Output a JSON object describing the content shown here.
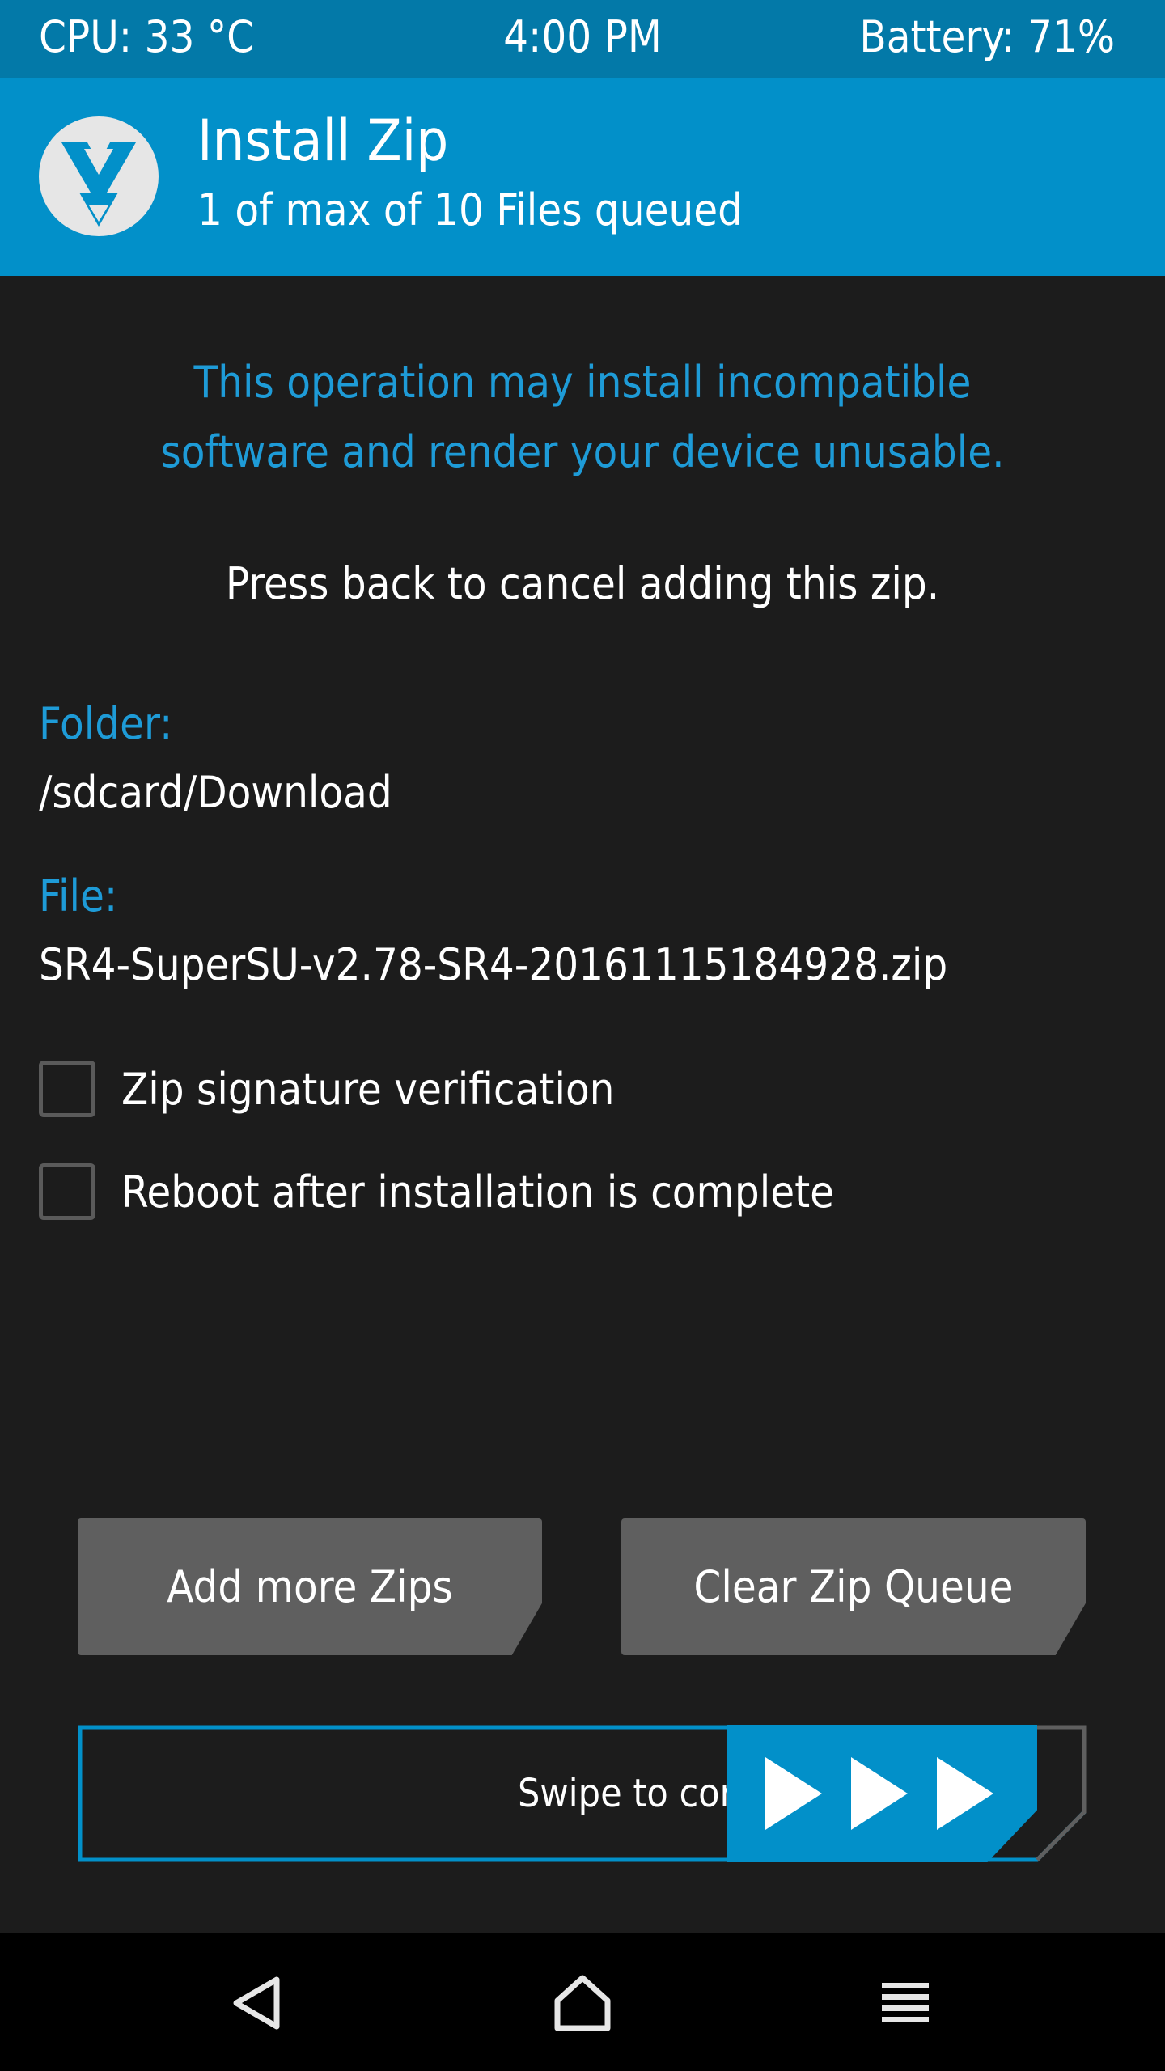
{
  "status_bar": {
    "cpu": "CPU: 33 °C",
    "time": "4:00 PM",
    "battery": "Battery: 71%"
  },
  "header": {
    "title": "Install Zip",
    "subtitle": "1 of max of 10 Files queued"
  },
  "warning": {
    "line1": "This operation may install incompatible",
    "line2": "software and render your device unusable."
  },
  "instruction": "Press back to cancel adding this zip.",
  "folder": {
    "label": "Folder:",
    "value": "/sdcard/Download"
  },
  "file": {
    "label": "File:",
    "value": "SR4-SuperSU-v2.78-SR4-20161115184928.zip"
  },
  "options": [
    {
      "label": "Zip signature verification",
      "checked": false
    },
    {
      "label": "Reboot after installation is complete",
      "checked": false
    }
  ],
  "buttons": {
    "add_more": "Add more Zips",
    "clear_queue": "Clear Zip Queue"
  },
  "swipe": {
    "label": "Swipe to confirm Flash"
  },
  "colors": {
    "status_bar_bg": "#0379a8",
    "header_bg": "#0290c9",
    "accent_text": "#1e9bd7",
    "background": "#1c1c1c",
    "button_bg": "#5f5f5f"
  },
  "icons": {
    "logo": "twrp-logo-icon",
    "nav_back": "back-triangle-icon",
    "nav_home": "home-icon",
    "nav_menu": "menu-icon"
  }
}
